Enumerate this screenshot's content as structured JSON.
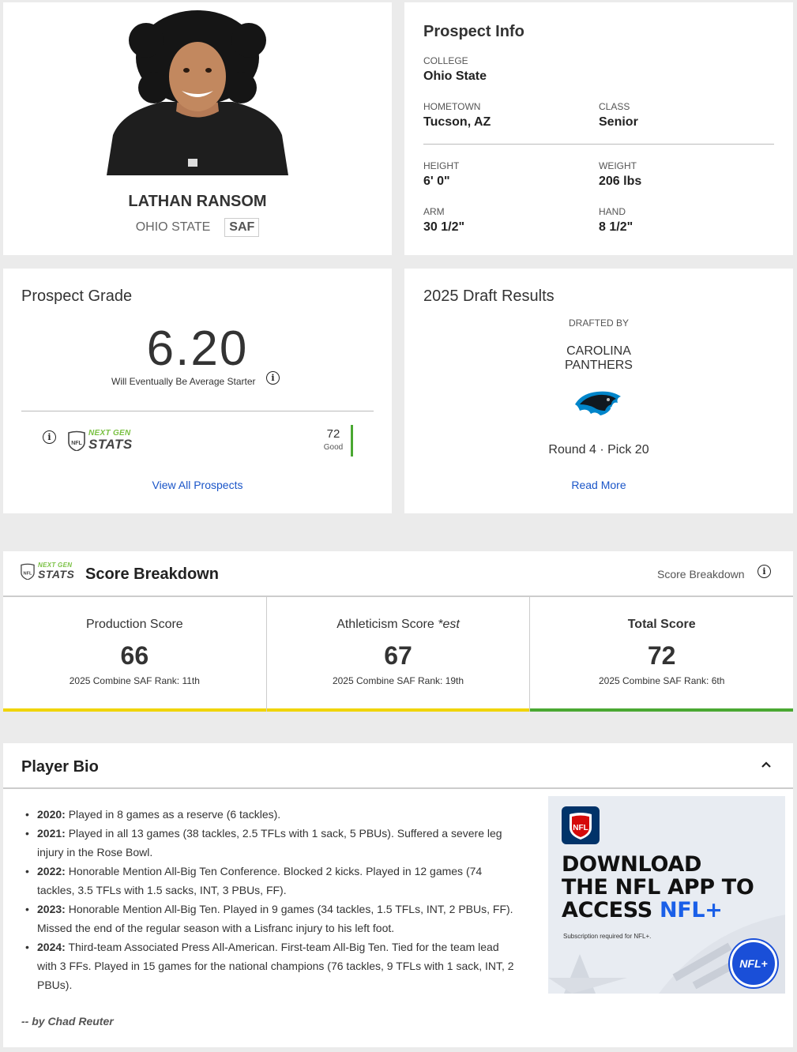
{
  "player": {
    "name": "LATHAN RANSOM",
    "school": "OHIO STATE",
    "position": "SAF"
  },
  "prospect_info": {
    "title": "Prospect Info",
    "college_label": "COLLEGE",
    "college": "Ohio State",
    "hometown_label": "HOMETOWN",
    "hometown": "Tucson, AZ",
    "class_label": "CLASS",
    "class": "Senior",
    "height_label": "HEIGHT",
    "height": "6' 0\"",
    "weight_label": "WEIGHT",
    "weight": "206 lbs",
    "arm_label": "ARM",
    "arm": "30 1/2\"",
    "hand_label": "HAND",
    "hand": "8 1/2\""
  },
  "prospect_grade": {
    "title": "Prospect Grade",
    "grade": "6.20",
    "grade_desc": "Will Eventually Be Average Starter",
    "ngs_top": "NEXT GEN",
    "ngs_bottom": "STATS",
    "ngs_score": "72",
    "ngs_rating": "Good",
    "link": "View All Prospects"
  },
  "draft": {
    "title": "2025 Draft Results",
    "drafted_by_label": "DRAFTED BY",
    "team_line1": "CAROLINA",
    "team_line2": "PANTHERS",
    "pick": "Round 4 · Pick 20",
    "link": "Read More"
  },
  "score_breakdown": {
    "ngs_top": "NEXT GEN",
    "ngs_bottom": "STATS",
    "title": "Score Breakdown",
    "right_label": "Score Breakdown",
    "scores": [
      {
        "label": "Production Score",
        "label_suffix": "",
        "value": "66",
        "rank": "2025 Combine SAF Rank: 11th",
        "bar_color": "#f0d400"
      },
      {
        "label": "Athleticism Score",
        "label_suffix": "*est",
        "value": "67",
        "rank": "2025 Combine SAF Rank: 19th",
        "bar_color": "#f0d400"
      },
      {
        "label": "Total Score",
        "label_suffix": "",
        "value": "72",
        "rank": "2025 Combine SAF Rank: 6th",
        "bar_color": "#4aa832"
      }
    ]
  },
  "bio": {
    "title": "Player Bio",
    "items": [
      {
        "year": "2020:",
        "text": " Played in 8 games as a reserve (6 tackles)."
      },
      {
        "year": "2021:",
        "text": " Played in all 13 games (38 tackles, 2.5 TFLs with 1 sack, 5 PBUs). Suffered a severe leg injury in the Rose Bowl."
      },
      {
        "year": "2022:",
        "text": " Honorable Mention All-Big Ten Conference. Blocked 2 kicks. Played in 12 games (74 tackles, 3.5 TFLs with 1.5 sacks, INT, 3 PBUs, FF)."
      },
      {
        "year": "2023:",
        "text": " Honorable Mention All-Big Ten. Played in 9 games (34 tackles, 1.5 TFLs, INT, 2 PBUs, FF). Missed the end of the regular season with a Lisfranc injury to his left foot."
      },
      {
        "year": "2024:",
        "text": " Third-team Associated Press All-American. First-team All-Big Ten. Tied for the team lead with 3 FFs. Played in 15 games for the national champions (76 tackles, 9 TFLs with 1 sack, INT, 2 PBUs)."
      }
    ],
    "author": "-- by Chad Reuter"
  },
  "ad": {
    "logo_text": "NFL",
    "line1": "DOWNLOAD",
    "line2": "THE NFL APP TO",
    "line3_prefix": "ACCESS ",
    "line3_highlight": "NFL+",
    "fine_print": "Subscription required for NFL+.",
    "badge": "NFL+"
  },
  "colors": {
    "link": "#1a55c8",
    "ngs_green": "#7ac143",
    "good_bar": "#4aa832",
    "mid_bar": "#f0d400",
    "nfl_blue": "#013369",
    "nfl_plus_blue": "#1a5fe8"
  }
}
